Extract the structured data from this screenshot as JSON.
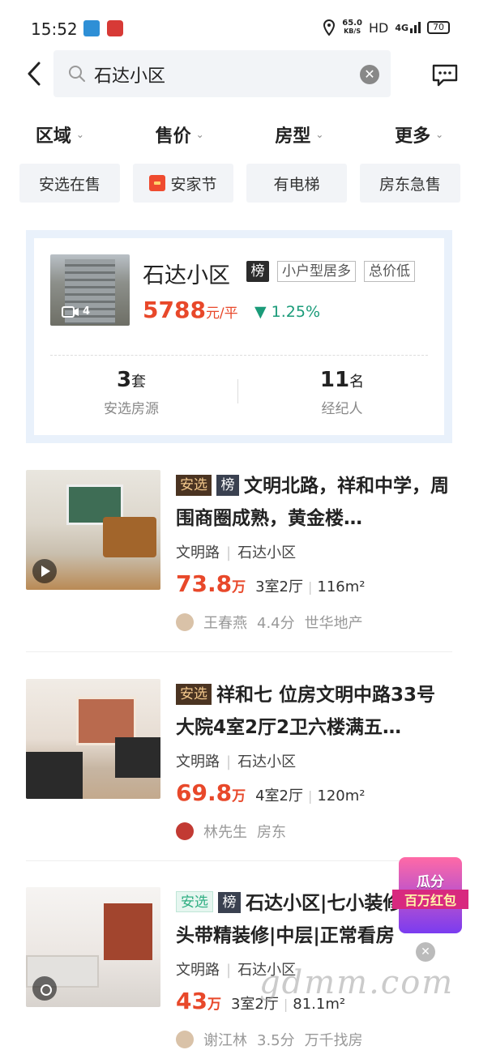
{
  "status": {
    "time": "15:52",
    "speed": "65.0",
    "speed_unit": "KB/S",
    "network": "HD",
    "signal": "4G",
    "battery": "70"
  },
  "search": {
    "query": "石达小区"
  },
  "filters": [
    "区域",
    "售价",
    "房型",
    "更多"
  ],
  "chips": [
    "安选在售",
    "安家节",
    "有电梯",
    "房东急售"
  ],
  "community": {
    "name": "石达小区",
    "rank_tag": "榜",
    "tags": [
      "小户型居多",
      "总价低"
    ],
    "video_count": "4",
    "price": "5788",
    "price_unit": "元/平",
    "change": "1.25%",
    "stats": [
      {
        "num": "3",
        "unit": "套",
        "label": "安选房源"
      },
      {
        "num": "11",
        "unit": "名",
        "label": "经纪人"
      }
    ]
  },
  "listings": [
    {
      "badge": "安选",
      "rank": "榜",
      "title": "文明北路，祥和中学，周围商圈成熟，黄金楼…",
      "area": "文明路",
      "community": "石达小区",
      "price": "73.8",
      "price_unit": "万",
      "rooms": "3室2厅",
      "size": "116m²",
      "agent": "王春燕",
      "score": "4.4分",
      "company": "世华地产"
    },
    {
      "badge": "安选",
      "title": "祥和七  位房文明中路33号大院4室2厅2卫六楼满五…",
      "area": "文明路",
      "community": "石达小区",
      "price": "69.8",
      "price_unit": "万",
      "rooms": "4室2厅",
      "size": "120m²",
      "agent": "林先生",
      "company": "房东"
    },
    {
      "badge": "安选",
      "rank": "榜",
      "title": "石达小区|七小装修|七字头带精装修|中层|正常看房",
      "area": "文明路",
      "community": "石达小区",
      "price": "43",
      "price_unit": "万",
      "rooms": "3室2厅",
      "size": "81.1m²",
      "agent": "谢江林",
      "score": "3.5分",
      "company": "万千找房"
    }
  ],
  "promo": {
    "line1": "瓜分",
    "line2": "百万红包"
  },
  "watermark": "gdmm.com"
}
